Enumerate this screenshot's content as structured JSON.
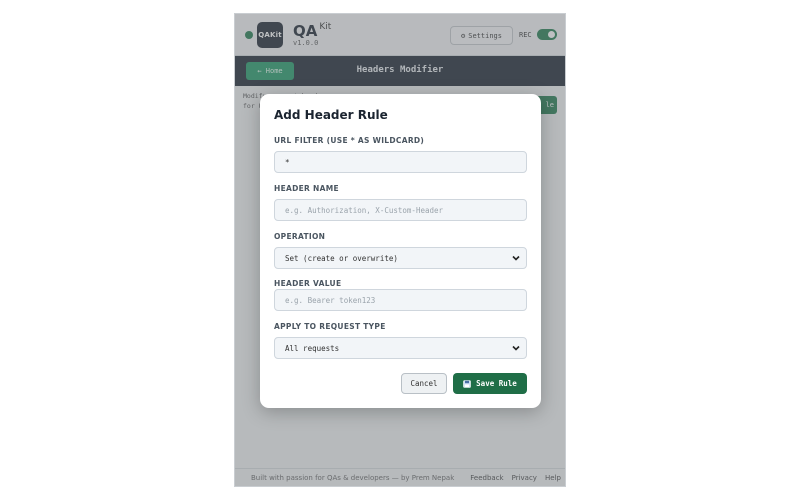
{
  "header": {
    "logo_text": "QAKit",
    "brand": "QA",
    "brand_sub": "Kit",
    "version": "v1.0.0",
    "settings_label": "Settings",
    "rec_label": "REC",
    "rec_on": true
  },
  "nav": {
    "home_label": "← Home",
    "title": "Headers Modifier"
  },
  "page": {
    "description": "Modify request headers for URLs",
    "add_rule_fragment": "le"
  },
  "modal": {
    "title": "Add Header Rule",
    "url_filter": {
      "label": "URL FILTER (USE * AS WILDCARD)",
      "value": "*"
    },
    "header_name": {
      "label": "HEADER NAME",
      "placeholder": "e.g. Authorization, X-Custom-Header"
    },
    "operation": {
      "label": "OPERATION",
      "selected": "Set (create or overwrite)"
    },
    "header_value": {
      "label": "HEADER VALUE",
      "placeholder": "e.g. Bearer token123"
    },
    "request_type": {
      "label": "APPLY TO REQUEST TYPE",
      "selected": "All requests"
    },
    "cancel_label": "Cancel",
    "save_label": "Save Rule"
  },
  "footer": {
    "credit": "Built with passion for QAs & developers — by Prem Nepak",
    "links": [
      "Feedback",
      "Privacy",
      "Help"
    ]
  },
  "colors": {
    "accent_green": "#1f7a4d",
    "nav_dark": "#1b2430",
    "home_green": "#1f9a66"
  }
}
